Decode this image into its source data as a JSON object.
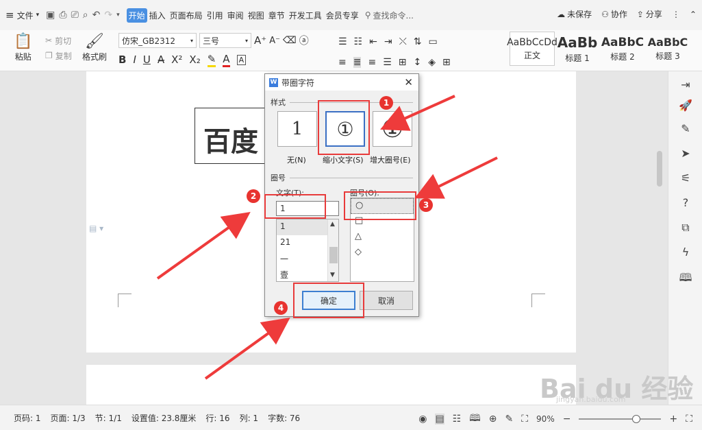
{
  "menubar": {
    "file_label": "文件",
    "tabs": [
      "开始",
      "插入",
      "页面布局",
      "引用",
      "审阅",
      "视图",
      "章节",
      "开发工具",
      "会员专享"
    ],
    "search_placeholder": "查找命令...",
    "unsaved_label": "未保存",
    "collab_label": "协作",
    "share_label": "分享"
  },
  "ribbon": {
    "paste_label": "粘贴",
    "cut_label": "剪切",
    "copy_label": "复制",
    "format_painter_label": "格式刷",
    "font_name": "仿宋_GB2312",
    "font_size": "三号",
    "styles": [
      {
        "sample": "AaBbCcDd",
        "name": "正文"
      },
      {
        "sample": "AaBb",
        "name": "标题 1"
      },
      {
        "sample": "AaBbC",
        "name": "标题 2"
      },
      {
        "sample": "AaBbC",
        "name": "标题 3"
      }
    ]
  },
  "document": {
    "boxed_text": "百度"
  },
  "dialog": {
    "title": "带圈字符",
    "style_section": "样式",
    "styles": [
      {
        "glyph": "1",
        "label": "无(N)"
      },
      {
        "glyph": "①",
        "label": "缩小文字(S)"
      },
      {
        "glyph": "①",
        "label": "增大圈号(E)"
      }
    ],
    "enclosure_section": "圈号",
    "text_label": "文字(T):",
    "text_value": "1",
    "text_options": [
      "1",
      "21",
      "一",
      "壹"
    ],
    "circle_label": "圈号(O):",
    "circle_options": [
      "○",
      "□",
      "△",
      "◇"
    ],
    "ok_label": "确定",
    "cancel_label": "取消"
  },
  "annotations": [
    "1",
    "2",
    "3",
    "4"
  ],
  "statusbar": {
    "page_num": "页码: 1",
    "pages": "页面: 1/3",
    "section": "节: 1/1",
    "setting": "设置值: 23.8厘米",
    "row": "行: 16",
    "col": "列: 1",
    "word_count": "字数: 76",
    "zoom": "90%"
  },
  "watermark": {
    "main": "Bai du 经验",
    "sub": "jingyan.baidu.com"
  }
}
